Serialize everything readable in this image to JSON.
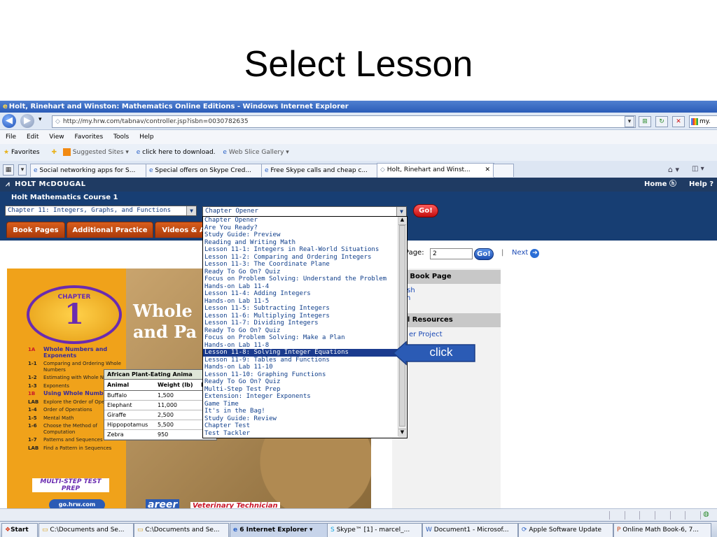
{
  "slide": {
    "title": "Select Lesson"
  },
  "window": {
    "title": "Holt, Rinehart and Winston: Mathematics Online Editions - Windows Internet Explorer"
  },
  "address": {
    "url": "http://my.hrw.com/tabnav/controller.jsp?isbn=0030782635",
    "right_tab": "my."
  },
  "menu": [
    "File",
    "Edit",
    "View",
    "Favorites",
    "Tools",
    "Help"
  ],
  "favorites": {
    "label": "Favorites",
    "suggested": "Suggested Sites ▾",
    "download": "click here to download.",
    "webslice": "Web Slice Gallery ▾"
  },
  "tabs": [
    "Social networking apps for S...",
    "Special offers on Skype Cred...",
    "Free Skype calls and cheap c...",
    "Holt, Rinehart and Winst..."
  ],
  "site": {
    "brand": "HOLT McDOUGAL",
    "home": "Home",
    "help": "Help",
    "course": "Holt Mathematics Course 1",
    "chapter_select": "Chapter 11: Integers, Graphs, and Functions",
    "lesson_select": "Chapter Opener",
    "go": "Go!",
    "nav_tabs": [
      "Book Pages",
      "Additional Practice",
      "Videos & A"
    ],
    "page_label": "Page:",
    "page_value": "2",
    "next": "Next",
    "right_headers": [
      "ed Book Page",
      "nal Resources"
    ],
    "right_links": [
      "nish",
      "ish",
      "er Project"
    ]
  },
  "book": {
    "chapter": "CHAPTER",
    "num": "1",
    "title1": "Whole",
    "title2": "and Pa",
    "toc": [
      {
        "n": "1A",
        "t": "Whole Numbers and Exponents",
        "head": true
      },
      {
        "n": "1-1",
        "t": "Comparing and Ordering Whole Numbers"
      },
      {
        "n": "1-2",
        "t": "Estimating with Whole Numbers"
      },
      {
        "n": "1-3",
        "t": "Exponents"
      },
      {
        "n": "1B",
        "t": "Using Whole Numbers",
        "head": true
      },
      {
        "n": "LAB",
        "t": "Explore the Order of Operations"
      },
      {
        "n": "1-4",
        "t": "Order of Operations"
      },
      {
        "n": "1-5",
        "t": "Mental Math"
      },
      {
        "n": "1-6",
        "t": "Choose the Method of Computation"
      },
      {
        "n": "1-7",
        "t": "Patterns and Sequences"
      },
      {
        "n": "LAB",
        "t": "Find a Pattern in Sequences"
      }
    ],
    "multi": "MULTI-STEP TEST PREP",
    "url": "go.hrw.com",
    "career": "areer",
    "career_title": "Veterinary Technician",
    "table_title": "African Plant-Eating Anima",
    "table_head": [
      "Animal",
      "Weight (lb)",
      "D"
    ],
    "table_rows": [
      [
        "Buffalo",
        "1,500"
      ],
      [
        "Elephant",
        "11,000"
      ],
      [
        "Giraffe",
        "2,500"
      ],
      [
        "Hippopotamus",
        "5,500"
      ],
      [
        "Zebra",
        "950"
      ]
    ]
  },
  "dropdown": [
    "Chapter Opener",
    "Are You Ready?",
    "Study Guide: Preview",
    "Reading and Writing Math",
    "Lesson 11-1: Integers in Real-World Situations",
    "Lesson 11-2: Comparing and Ordering Integers",
    "Lesson 11-3: The Coordinate Plane",
    "Ready To Go On? Quiz",
    "Focus on Problem Solving: Understand the Problem",
    "Hands-on Lab 11-4",
    "Lesson 11-4: Adding Integers",
    "Hands-on Lab 11-5",
    "Lesson 11-5: Subtracting Integers",
    "Lesson 11-6: Multiplying Integers",
    "Lesson 11-7: Dividing Integers",
    "Ready To Go On? Quiz",
    "Focus on Problem Solving: Make a Plan",
    "Hands-on Lab 11-8",
    "Lesson 11-8: Solving Integer Equations",
    "Lesson 11-9: Tables and Functions",
    "Hands-on Lab 11-10",
    "Lesson 11-10: Graphing Functions",
    "Ready To Go On? Quiz",
    "Multi-Step Test Prep",
    "Extension: Integer Exponents",
    "Game Time",
    "It's in the Bag!",
    "Study Guide: Review",
    "Chapter Test",
    "Test Tackler"
  ],
  "selected_index": 18,
  "callout": "click",
  "taskbar": {
    "start": "Start",
    "items": [
      "C:\\Documents and Se...",
      "C:\\Documents and Se...",
      "6 Internet Explorer ▾",
      "Skype™ [1] - marcel_...",
      "Document1 - Microsof...",
      "Apple Software Update",
      "Online Math Book-6, 7..."
    ]
  },
  "colors": {
    "accent": "#173e73",
    "tab": "#c24a12",
    "selected": "#1b3b8e",
    "callout": "#2b5bb5"
  }
}
